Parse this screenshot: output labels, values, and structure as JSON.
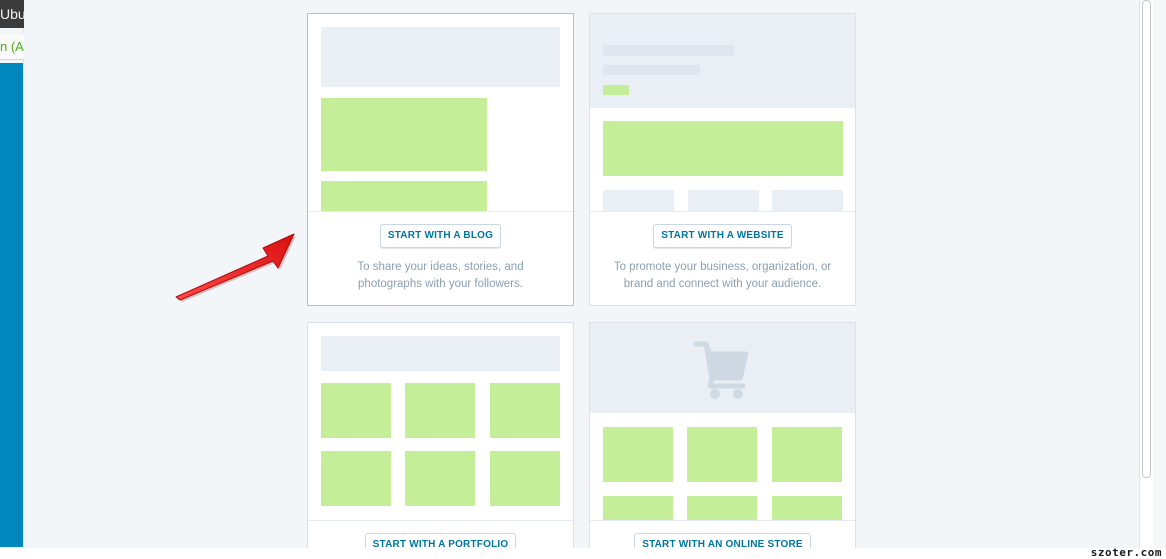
{
  "background_window": {
    "tab_text": "Ubun",
    "row_text": "n (Au"
  },
  "cards": {
    "blog": {
      "button": "START WITH A BLOG",
      "desc_line1": "To share your ideas, stories, and",
      "desc_line2": "photographs with your followers."
    },
    "website": {
      "button": "START WITH A WEBSITE",
      "desc_line1": "To promote your business, organization, or",
      "desc_line2": "brand and connect with your audience."
    },
    "portfolio": {
      "button": "START WITH A PORTFOLIO"
    },
    "store": {
      "button": "START WITH AN ONLINE STORE",
      "icon": "shopping-cart-icon"
    }
  },
  "annotation": {
    "icon": "red-arrow-icon",
    "color": "#e81c1c"
  },
  "colors": {
    "accent_blue": "#0087be",
    "placeholder_green": "#c4ef98",
    "placeholder_gray": "#e9eff5"
  },
  "watermark": "szoter.com"
}
